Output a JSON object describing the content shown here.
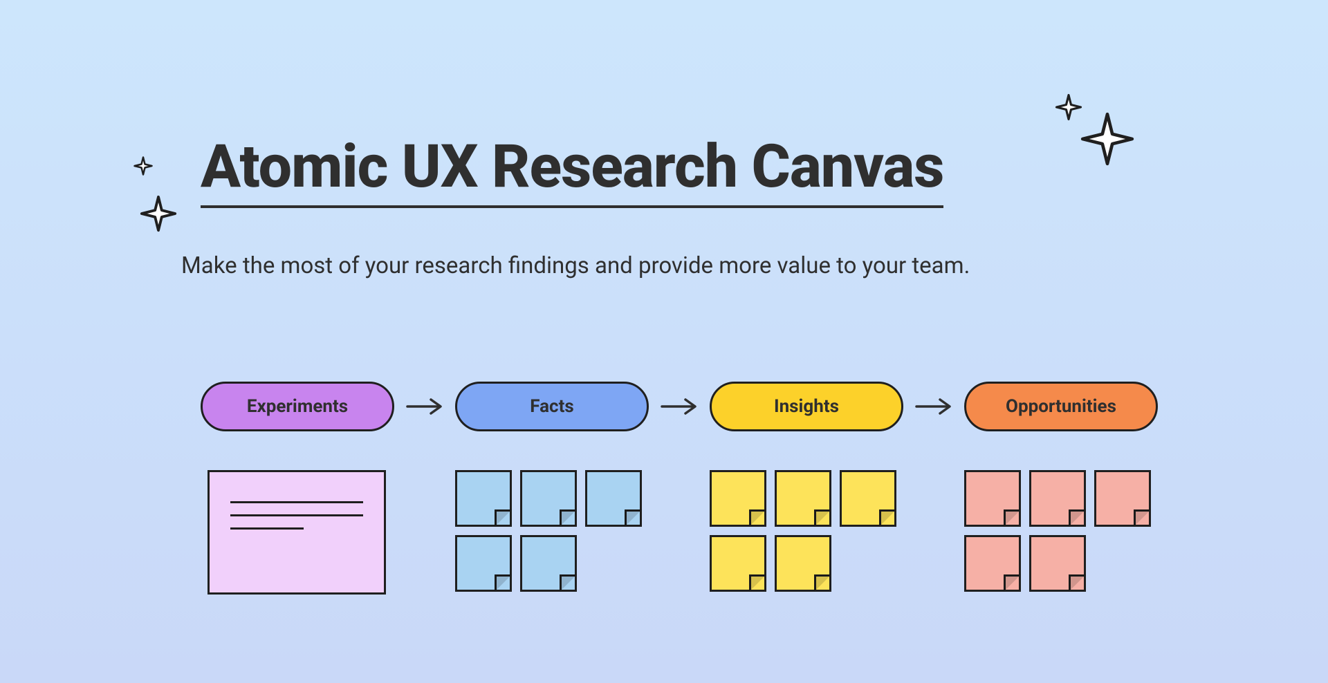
{
  "header": {
    "title": "Atomic UX Research Canvas",
    "subtitle": "Make the most of your research findings and provide more value to your team."
  },
  "stages": {
    "experiments": {
      "label": "Experiments",
      "color": "#c884ee"
    },
    "facts": {
      "label": "Facts",
      "color": "#7ea6f4"
    },
    "insights": {
      "label": "Insights",
      "color": "#fcd12a"
    },
    "opportunities": {
      "label": "Opportunities",
      "color": "#f58a4b"
    }
  },
  "notes": {
    "facts_count": 5,
    "insights_count": 5,
    "opportunities_count": 5
  },
  "icons": {
    "sparkle": "sparkle-icon",
    "arrow": "arrow-right-icon"
  }
}
